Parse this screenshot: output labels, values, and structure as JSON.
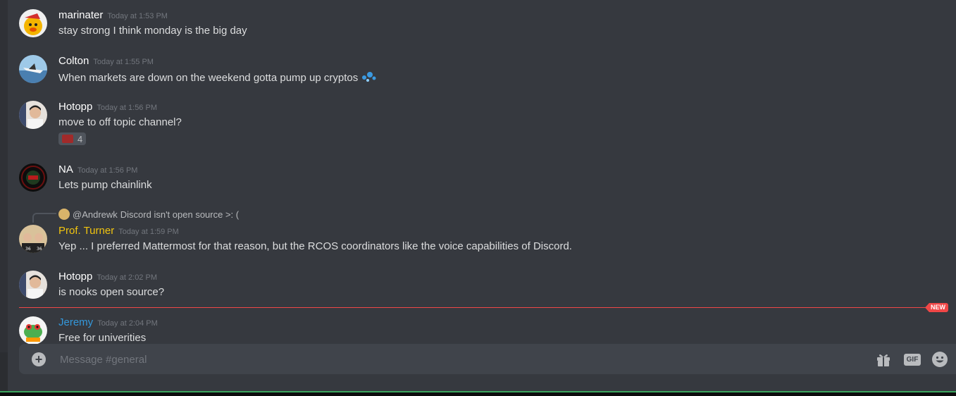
{
  "messages": [
    {
      "author": "marinater",
      "timestamp": "Today at 1:53 PM",
      "content": "stay strong I think monday is the big day",
      "author_color": "#ffffff"
    },
    {
      "author": "Colton",
      "timestamp": "Today at 1:55 PM",
      "content": "When markets are down on the weekend gotta pump up cryptos",
      "author_color": "#ffffff",
      "emoji": "splash-emoji"
    },
    {
      "author": "Hotopp",
      "timestamp": "Today at 1:56 PM",
      "content": "move to off topic channel?",
      "author_color": "#ffffff",
      "reaction": {
        "emoji": "flag-emoji",
        "count": "4"
      }
    },
    {
      "author": "NA",
      "timestamp": "Today at 1:56 PM",
      "content": "Lets pump chainlink",
      "author_color": "#ffffff"
    },
    {
      "author": "Prof. Turner",
      "timestamp": "Today at 1:59 PM",
      "content": "Yep ... I preferred Mattermost for that reason, but the RCOS coordinators like the voice capabilities of Discord.",
      "author_color": "#f1c40f",
      "reply": {
        "mention": "@Andrewk",
        "text": "Discord isn't open source >: ("
      }
    },
    {
      "author": "Hotopp",
      "timestamp": "Today at 2:02 PM",
      "content": "is nooks open source?",
      "author_color": "#ffffff"
    },
    {
      "author": "Jeremy",
      "timestamp": "Today at 2:04 PM",
      "content": "Free for univerities",
      "author_color": "#3498db"
    }
  ],
  "divider": {
    "label": "NEW"
  },
  "composer": {
    "placeholder": "Message #general"
  },
  "colors": {
    "background": "#36393f",
    "composer": "#40444b",
    "new_divider": "#f04747",
    "accent": "#3ba55d"
  }
}
